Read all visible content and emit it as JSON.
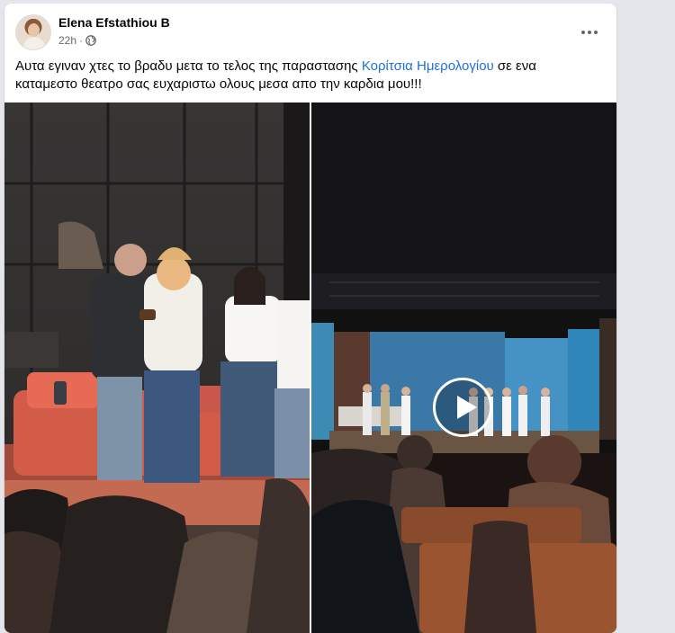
{
  "post": {
    "author_name": "Elena Efstathiou B",
    "time": "22h",
    "separator": "·",
    "audience_icon": "globe-icon",
    "more_icon": "more-options-icon",
    "text_before": "Αυτα εγιναν χτες το βραδυ μετα το τελος της παραστασης ",
    "link_text": "Κορίτσια Ημερολογίου",
    "text_after": " σε ενα καταμεστο θεατρο σας ευχαριστω ολους μεσα απο την καρδια μου!!!"
  },
  "media": {
    "left_photo": "stage-photo",
    "right_video": "stage-video",
    "play_icon": "play-icon"
  },
  "colors": {
    "link": "#216fdb",
    "text": "#050505",
    "secondary_text": "#65676b",
    "background": "#e4e6eb"
  }
}
